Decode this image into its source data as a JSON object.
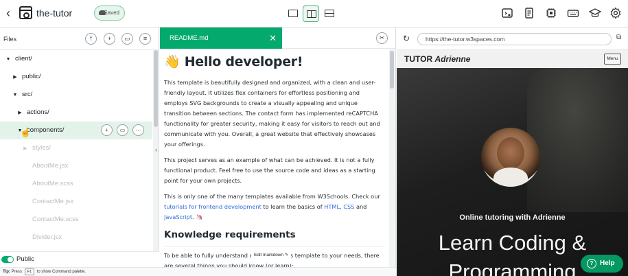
{
  "topbar": {
    "app_name": "the-tutor",
    "saved_label": "Saved"
  },
  "files": {
    "title": "Files",
    "tree": [
      {
        "label": "client/",
        "caret": "▼",
        "indent": 0,
        "state": "normal"
      },
      {
        "label": "public/",
        "caret": "▶",
        "indent": 1,
        "state": "normal"
      },
      {
        "label": "src/",
        "caret": "▼",
        "indent": 1,
        "state": "normal"
      },
      {
        "label": "actions/",
        "caret": "▶",
        "indent": 2,
        "state": "normal"
      },
      {
        "label": "components/",
        "caret": "▼",
        "indent": 2,
        "state": "highlighted"
      },
      {
        "label": "styles/",
        "caret": "▶",
        "indent": 3,
        "state": "dim"
      },
      {
        "label": "AboutMe.jsx",
        "caret": "",
        "indent": 3,
        "state": "dim"
      },
      {
        "label": "AboutMe.scss",
        "caret": "",
        "indent": 3,
        "state": "dim"
      },
      {
        "label": "ContactMe.jsx",
        "caret": "",
        "indent": 3,
        "state": "dim"
      },
      {
        "label": "ContactMe.scss",
        "caret": "",
        "indent": 3,
        "state": "dim"
      },
      {
        "label": "Divider.jsx",
        "caret": "",
        "indent": 3,
        "state": "dim"
      }
    ],
    "public_label": "Public"
  },
  "editor": {
    "tab_label": "README.md",
    "h1_emoji": "👋",
    "h1": "Hello developer!",
    "p1": "This template is beautifully designed and organized, with a clean and user-friendly layout. It utilizes flex containers for effortless positioning and employs SVG backgrounds to create a visually appealing and unique transition between sections. The contact form has implemented reCAPTCHA functionality for greater security, making it easy for visitors to reach out and communicate with you. Overall, a great website that effectively showcases your offerings.",
    "p2": "This project serves as an example of what can be achieved. It is not a fully functional product. Feel free to use the source code and ideas as a starting point for your own projects.",
    "p3_before": "This is only one of the many templates available from W3Schools. Check our ",
    "p3_link1": "tutorials for frontend development",
    "p3_mid1": " to learn the basics of ",
    "p3_link2": "HTML",
    "p3_mid2": ", ",
    "p3_link3": "CSS",
    "p3_mid3": " and ",
    "p3_link4": "JavaScript",
    "p3_end": ". 🦄",
    "h2": "Knowledge requirements",
    "p4": "To be able to fully understand and modify this template to your needs, there are several things you should know (or learn):",
    "edit_markdown_label": "Edit markdown"
  },
  "preview": {
    "url": "https://the-tutor.w3spaces.com",
    "brand_plain": "TUTOR",
    "brand_italic": "Adrienne",
    "menu_label": "Menu",
    "subtitle": "Online tutoring with Adrienne",
    "title_line1": "Learn Coding &",
    "title_line2": "Programming"
  },
  "help_label": "Help",
  "status": {
    "tip_label": "Tip:",
    "press": "Press",
    "key": "F1",
    "rest": "to show Command palette."
  }
}
